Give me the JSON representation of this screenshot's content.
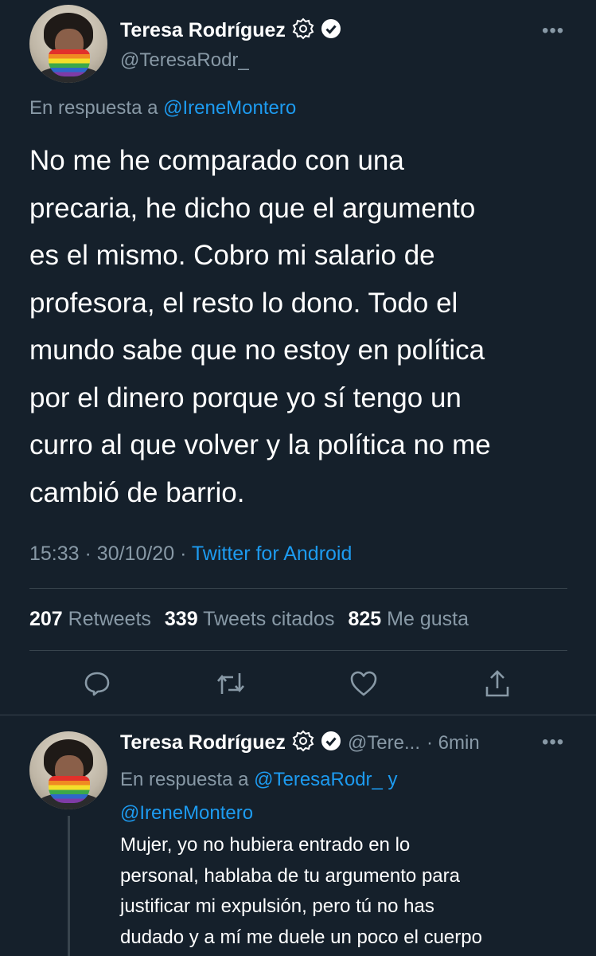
{
  "tweet": {
    "author_name": "Teresa Rodríguez",
    "author_handle": "@TeresaRodr_",
    "reply_prefix": "En respuesta a",
    "reply_to": "@IreneMontero",
    "text_lines": [
      "No me he comparado con una",
      "precaria, he dicho que el argumento",
      "es el mismo. Cobro mi salario de",
      "profesora, el resto lo dono. Todo el",
      "mundo sabe que no estoy en política",
      "por el dinero porque yo sí tengo un",
      "curro al que volver y la política no me",
      "cambió de barrio."
    ],
    "time": "15:33",
    "date": "30/10/20",
    "separator": "·",
    "source": "Twitter for Android",
    "stats": {
      "retweets_count": "207",
      "retweets_label": "Retweets",
      "quotes_count": "339",
      "quotes_label": "Tweets citados",
      "likes_count": "825",
      "likes_label": "Me gusta"
    }
  },
  "reply": {
    "author_name": "Teresa Rodríguez",
    "author_handle": "@Tere...",
    "time_ago": "· 6min",
    "reply_prefix": "En respuesta a",
    "reply_to_1": "@TeresaRodr_",
    "reply_conj": "y",
    "reply_to_2": "@IreneMontero",
    "text_lines": [
      "Mujer, yo no hubiera entrado en lo",
      "personal, hablaba de tu argumento para",
      "justificar mi expulsión, pero tú no has",
      "dudado y a mí me duele un poco el cuerpo"
    ]
  },
  "more_menu": "•••",
  "colors": {
    "background": "#15202b",
    "accent": "#1d9bf0",
    "secondary_text": "#8899a6",
    "divider": "#38444d"
  },
  "icons": [
    "verified-settings-icon",
    "verified-check-icon",
    "more-icon",
    "reply-icon",
    "retweet-icon",
    "like-icon",
    "share-icon"
  ]
}
